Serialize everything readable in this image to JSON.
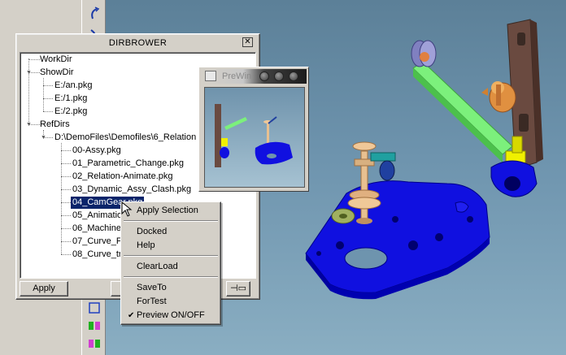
{
  "dirbrower": {
    "title": "DIRBROWER",
    "tree": {
      "workdir": "WorkDir",
      "showdir": "ShowDir",
      "showdir_items": [
        "E:/an.pkg",
        "E:/1.pkg",
        "E:/2.pkg"
      ],
      "refdirs": "RefDirs",
      "relation_folder": "D:\\DemoFiles\\Demofiles\\6_Relation",
      "relation_items": [
        "00-Assy.pkg",
        "01_Parametric_Change.pkg",
        "02_Relation-Animate.pkg",
        "03_Dynamic_Assy_Clash.pkg",
        "04_CamGear.pkg",
        "05_Animation",
        "06_Machine_",
        "07_Curve_Fu",
        "08_Curve_tr"
      ],
      "selected_index": 4
    },
    "buttons": {
      "apply": "Apply"
    }
  },
  "prewin": {
    "title": "PreWin"
  },
  "context_menu": {
    "items": [
      {
        "label": "Apply Selection"
      },
      {
        "label": "Docked"
      },
      {
        "label": "Help"
      },
      {
        "label": "ClearLoad"
      },
      {
        "label": "SaveTo"
      },
      {
        "label": "ForTest"
      },
      {
        "label": "Preview ON/OFF",
        "checked": true
      }
    ]
  },
  "colors": {
    "viewport_top": "#5c8098",
    "viewport_bottom": "#8aaec2",
    "selection": "#0a246a",
    "base_plate": "#1010e0",
    "rack": "#7cf07c",
    "cam_yellow": "#f0f000",
    "frame_brown": "#6a4a40",
    "gear_orange": "#e09040",
    "gear_purple": "#8080c0"
  }
}
